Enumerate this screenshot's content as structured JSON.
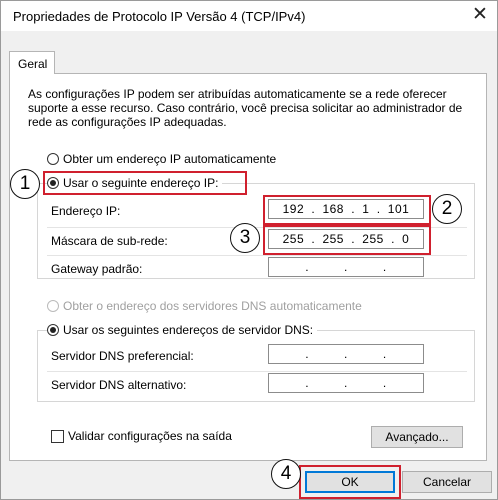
{
  "window": {
    "title": "Propriedades de Protocolo IP Versão 4 (TCP/IPv4)",
    "close_glyph": "✕"
  },
  "tabs": [
    {
      "label": "Geral"
    }
  ],
  "description": "As configurações IP podem ser atribuídas automaticamente se a rede oferecer suporte a esse recurso. Caso contrário, você precisa solicitar ao administrador de rede as configurações IP adequadas.",
  "ip_options": {
    "auto": "Obter um endereço IP automaticamente",
    "manual": "Usar o seguinte endereço IP:",
    "selected": "manual"
  },
  "ip_fields": {
    "address_label": "Endereço IP:",
    "address_value": [
      "192",
      "168",
      "1",
      "101"
    ],
    "mask_label": "Máscara de sub-rede:",
    "mask_value": [
      "255",
      "255",
      "255",
      "0"
    ],
    "gateway_label": "Gateway padrão:",
    "gateway_value": [
      "",
      "",
      "",
      ""
    ]
  },
  "dns_options": {
    "auto": "Obter o endereço dos servidores DNS automaticamente",
    "manual": "Usar os seguintes endereços de servidor DNS:",
    "selected": "manual"
  },
  "dns_fields": {
    "preferred_label": "Servidor DNS preferencial:",
    "preferred_value": [
      "",
      "",
      "",
      ""
    ],
    "alternate_label": "Servidor DNS alternativo:",
    "alternate_value": [
      "",
      "",
      "",
      ""
    ]
  },
  "validate_label": "Validar configurações na saída",
  "buttons": {
    "advanced": "Avançado...",
    "ok": "OK",
    "cancel": "Cancelar"
  },
  "callouts": [
    "1",
    "2",
    "3",
    "4"
  ],
  "colors": {
    "highlight": "#d0202e",
    "default_button_border": "#0078d7"
  }
}
